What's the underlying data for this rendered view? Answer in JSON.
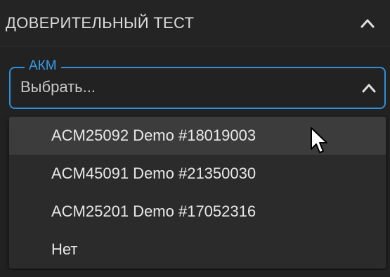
{
  "section": {
    "title": "ДОВЕРИТЕЛЬНЫЙ ТЕСТ"
  },
  "field": {
    "label": "АКМ",
    "placeholder": "Выбрать..."
  },
  "dropdown": {
    "options": [
      {
        "label": "ACM25092 Demo #18019003",
        "highlighted": true
      },
      {
        "label": "ACM45091 Demo #21350030",
        "highlighted": false
      },
      {
        "label": "ACM25201 Demo #17052316",
        "highlighted": false
      },
      {
        "label": "Нет",
        "highlighted": false
      }
    ]
  },
  "colors": {
    "accent": "#2f8fd8",
    "background": "#222222",
    "dropdown_bg": "#2b2b2b",
    "highlight_bg": "#3c3c3c"
  },
  "icons": {
    "header_collapse": "chevron-up-icon",
    "field_toggle": "chevron-up-icon",
    "pointer": "mouse-cursor-icon"
  }
}
